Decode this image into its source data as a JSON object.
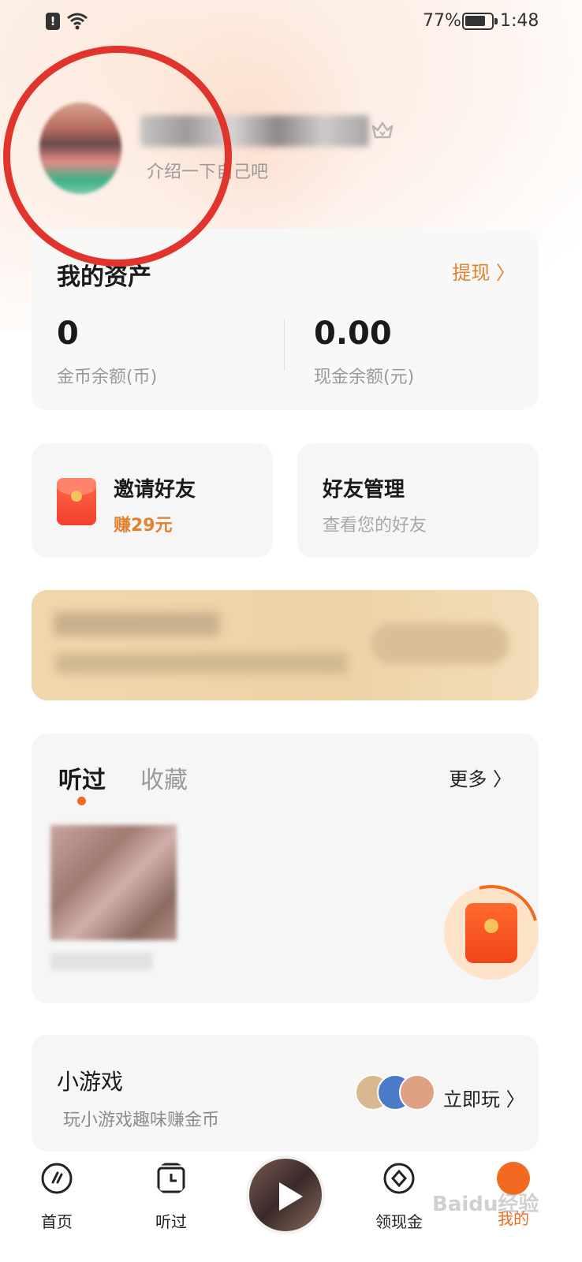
{
  "status_bar": {
    "battery_percent": "77%",
    "time": "1:48",
    "alert_glyph": "!"
  },
  "profile": {
    "bio": "介绍一下自己吧"
  },
  "assets": {
    "title": "我的资产",
    "withdraw_label": "提现 〉",
    "coins_value": "0",
    "coins_label": "金币余额(币)",
    "cash_value": "0.00",
    "cash_label": "现金余额(元)"
  },
  "invite": {
    "title": "邀请好友",
    "subtitle": "赚29元"
  },
  "friends": {
    "title": "好友管理",
    "subtitle": "查看您的好友"
  },
  "history": {
    "tab_heard": "听过",
    "tab_favorites": "收藏",
    "more_label": "更多 〉"
  },
  "games": {
    "title": "小游戏",
    "subtitle": "玩小游戏趣味赚金币",
    "play_label": "立即玩 〉"
  },
  "tabbar": {
    "home": "首页",
    "heard": "听过",
    "cash": "领现金",
    "mine": "我的"
  },
  "watermark": "Baidu经验",
  "colors": {
    "accent": "#f26a1f",
    "withdraw": "#e0822e",
    "annotation_circle": "#e0342c"
  }
}
